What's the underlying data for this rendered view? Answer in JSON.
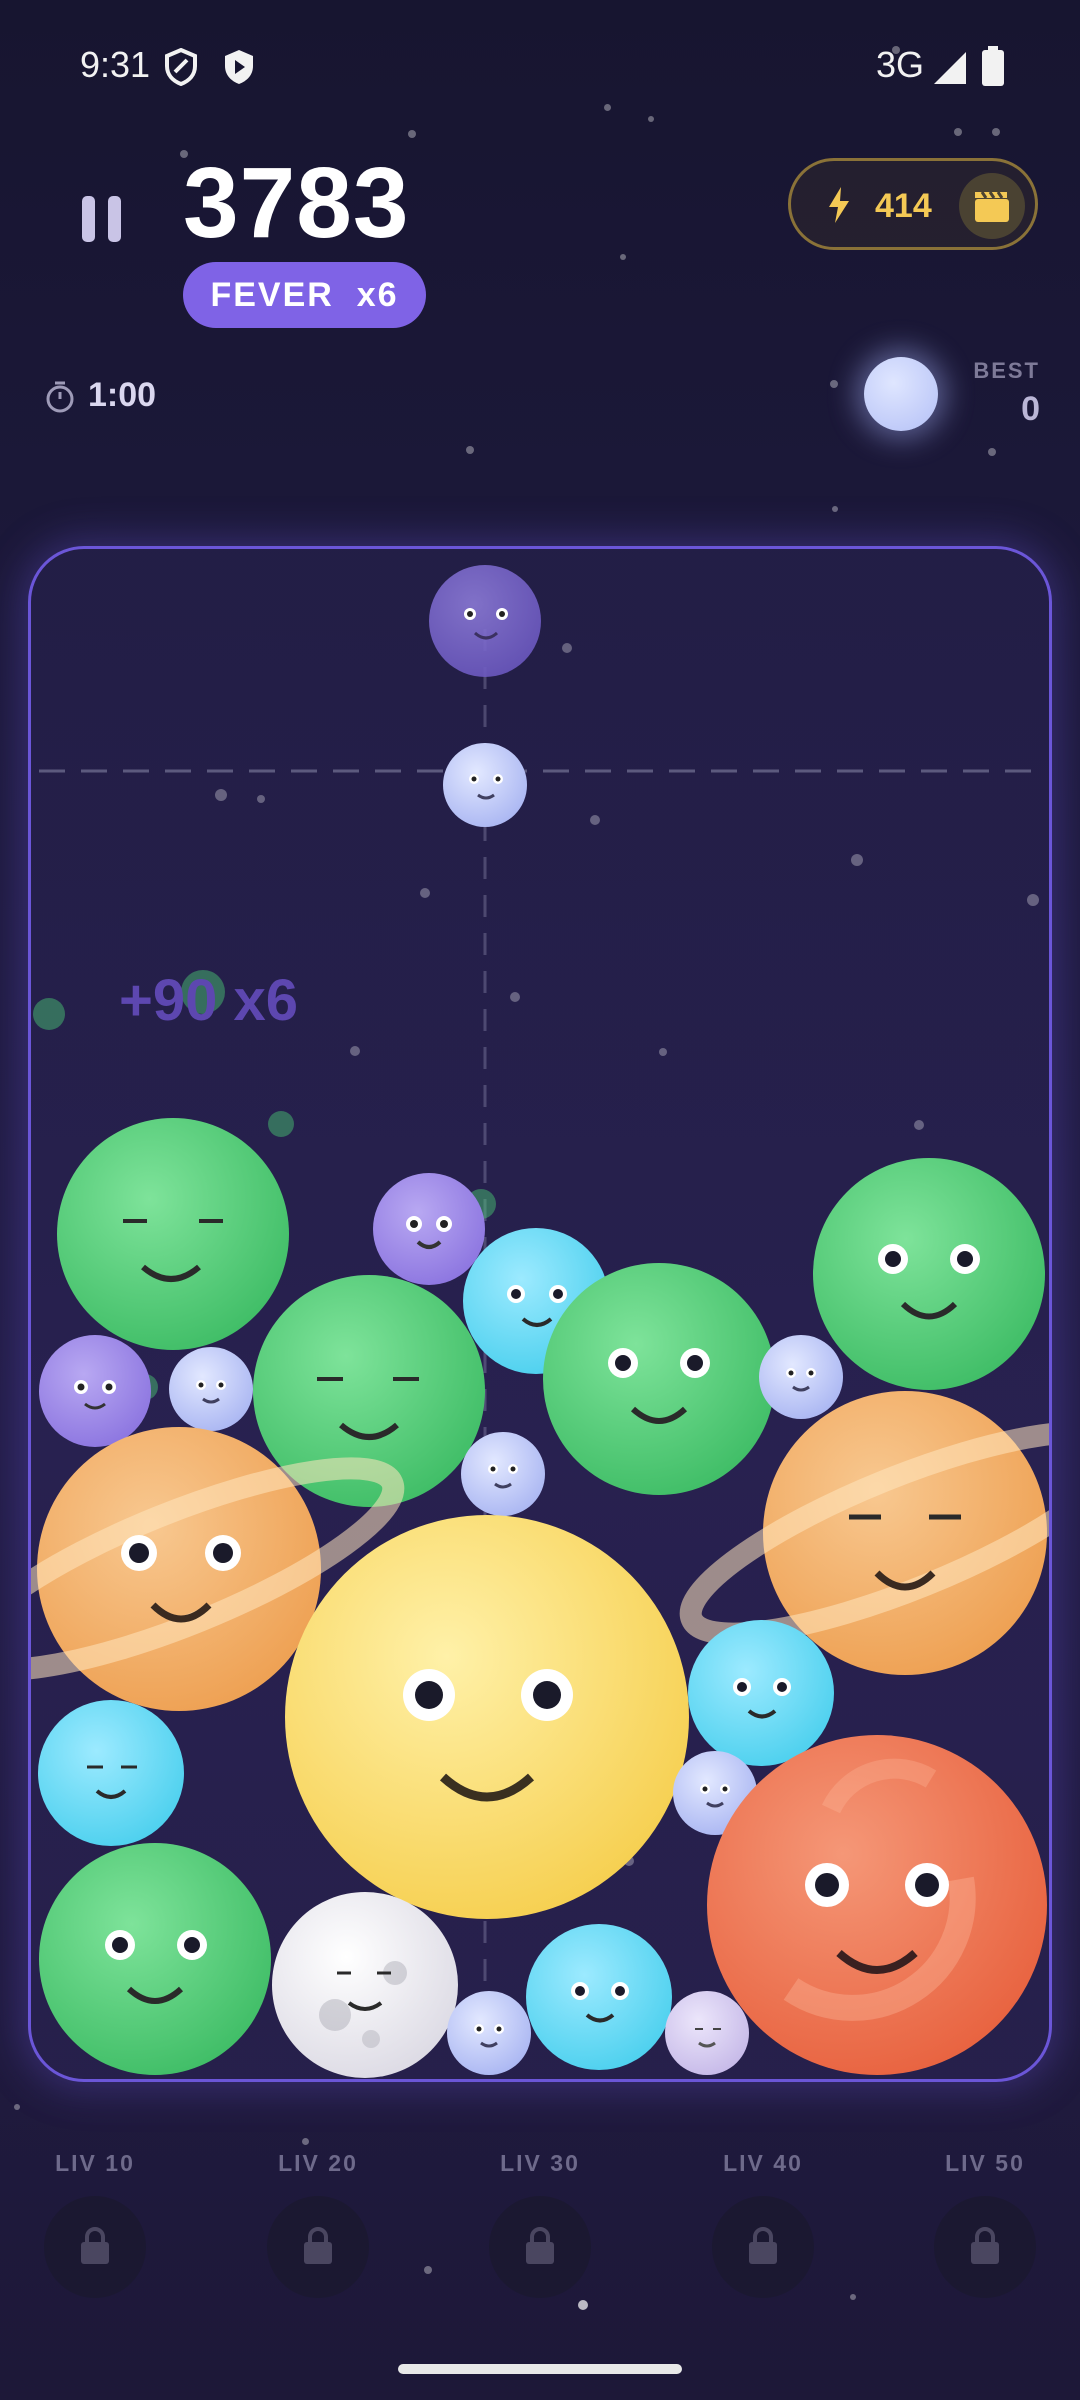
{
  "status_bar": {
    "time": "9:31",
    "network": "3G",
    "icons": [
      "shield-outline-icon",
      "shield-play-icon",
      "signal-icon",
      "battery-icon"
    ]
  },
  "header": {
    "score": "3783",
    "fever": "FEVER  x6",
    "energy": "414",
    "timer": "1:00",
    "best_label": "BEST",
    "best_value": "0",
    "icons": [
      "pause-icon",
      "bolt-icon",
      "clapperboard-icon",
      "stopwatch-icon"
    ]
  },
  "game": {
    "popup": "+90 x6",
    "colors": {
      "green": "#4ccf75",
      "yellow": "#f8d65e",
      "orange": "#f0a85a",
      "red": "#ec6d4a",
      "cyan": "#5ad7f2",
      "purple": "#9b86e8",
      "periwinkle": "#b4c0f6",
      "white": "#e8e6ee",
      "lilac": "#d3c8ee"
    }
  },
  "levels": [
    {
      "label": "LIV 10",
      "locked": true
    },
    {
      "label": "LIV 20",
      "locked": true
    },
    {
      "label": "LIV 30",
      "locked": true
    },
    {
      "label": "LIV 40",
      "locked": true
    },
    {
      "label": "LIV 50",
      "locked": true
    }
  ]
}
